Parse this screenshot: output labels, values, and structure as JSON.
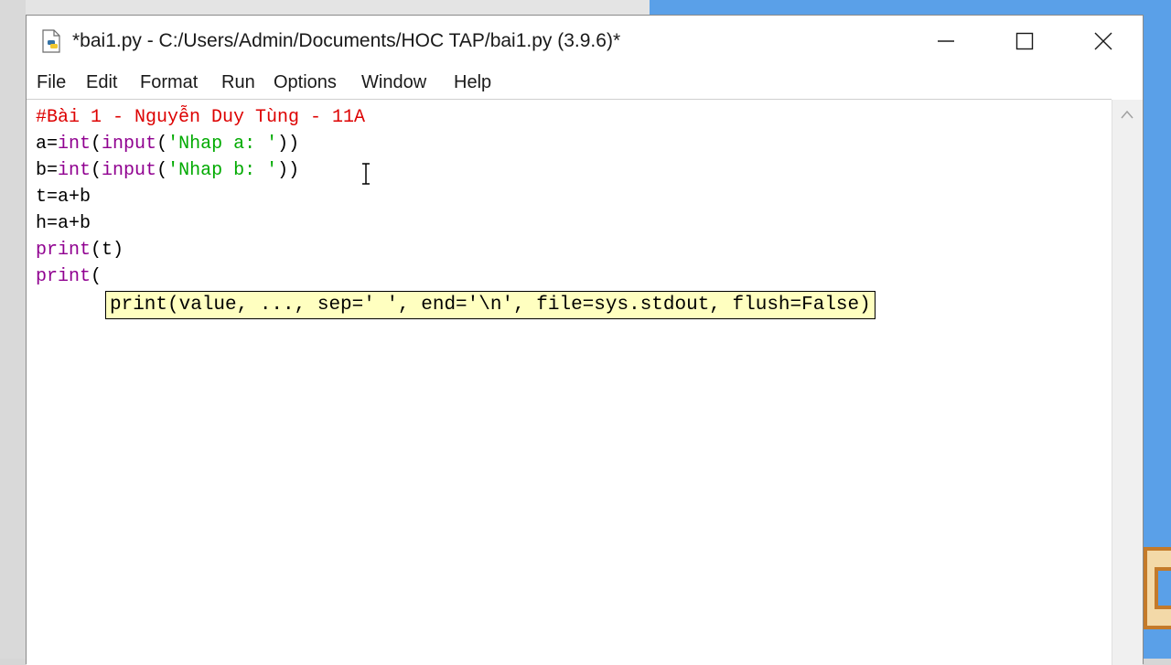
{
  "window": {
    "title": "*bai1.py - C:/Users/Admin/Documents/HOC TAP/bai1.py (3.9.6)*",
    "controls": {
      "minimize": "minimize",
      "maximize": "maximize",
      "close": "close"
    }
  },
  "menubar": {
    "items": [
      "File",
      "Edit",
      "Format",
      "Run",
      "Options",
      "Window",
      "Help"
    ]
  },
  "editor": {
    "lines": [
      {
        "parts": [
          {
            "t": "#Bài 1 - Nguyễn Duy Tùng - 11A",
            "c": "comment"
          }
        ]
      },
      {
        "parts": [
          {
            "t": "a=",
            "c": ""
          },
          {
            "t": "int",
            "c": "builtin"
          },
          {
            "t": "(",
            "c": ""
          },
          {
            "t": "input",
            "c": "builtin"
          },
          {
            "t": "(",
            "c": ""
          },
          {
            "t": "'Nhap a: '",
            "c": "string"
          },
          {
            "t": "))",
            "c": ""
          }
        ]
      },
      {
        "parts": [
          {
            "t": "b=",
            "c": ""
          },
          {
            "t": "int",
            "c": "builtin"
          },
          {
            "t": "(",
            "c": ""
          },
          {
            "t": "input",
            "c": "builtin"
          },
          {
            "t": "(",
            "c": ""
          },
          {
            "t": "'Nhap b: '",
            "c": "string"
          },
          {
            "t": "))",
            "c": ""
          }
        ]
      },
      {
        "parts": [
          {
            "t": "t=a+b",
            "c": ""
          }
        ]
      },
      {
        "parts": [
          {
            "t": "h=a+b",
            "c": ""
          }
        ]
      },
      {
        "parts": [
          {
            "t": "print",
            "c": "builtin"
          },
          {
            "t": "(t)",
            "c": ""
          }
        ]
      },
      {
        "parts": [
          {
            "t": "print",
            "c": "builtin"
          },
          {
            "t": "(",
            "c": ""
          }
        ]
      }
    ],
    "calltip": "print(value, ..., sep=' ', end='\\n', file=sys.stdout, flush=False)"
  },
  "colors": {
    "comment": "#dd0000",
    "builtin": "#900090",
    "string": "#00aa00",
    "calltip_bg": "#ffffc0"
  },
  "icons": {
    "app": "python-file-icon",
    "cursor": "text-cursor-icon",
    "scroll_up": "chevron-up-icon"
  }
}
